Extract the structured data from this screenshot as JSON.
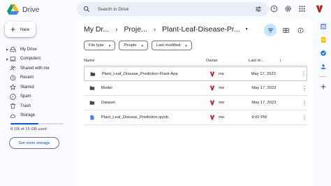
{
  "app": {
    "name": "Drive"
  },
  "search": {
    "placeholder": "Search in Drive"
  },
  "new_button": {
    "label": "New"
  },
  "sidebar": {
    "items": [
      {
        "label": "My Drive",
        "icon": "my-drive-icon",
        "expandable": true
      },
      {
        "label": "Computers",
        "icon": "computer-icon",
        "expandable": true
      },
      {
        "label": "Shared with me",
        "icon": "shared-icon",
        "expandable": false
      },
      {
        "label": "Recent",
        "icon": "clock-icon",
        "expandable": false
      },
      {
        "label": "Starred",
        "icon": "star-icon",
        "expandable": false
      },
      {
        "label": "Spam",
        "icon": "spam-icon",
        "expandable": false
      },
      {
        "label": "Trash",
        "icon": "trash-icon",
        "expandable": false
      },
      {
        "label": "Storage",
        "icon": "cloud-icon",
        "expandable": false
      }
    ],
    "storage_text": "8 GB of 15 GB used",
    "storage_used_fraction": 0.53,
    "get_storage_label": "Get more storage"
  },
  "breadcrumb": {
    "items": [
      "My Dr...",
      "Proje...",
      "Plant-Leaf-Disease-Pr..."
    ]
  },
  "filters": {
    "chips": [
      "File type",
      "People",
      "Last modified"
    ]
  },
  "table": {
    "headers": {
      "name": "Name",
      "owner": "Owner",
      "modified": "Last m..."
    },
    "rows": [
      {
        "name": "Plant_Leaf_Disease_Prediction-Flask-App",
        "type": "folder",
        "owner": "me",
        "modified": "May 17, 2023",
        "selected": true
      },
      {
        "name": "Model",
        "type": "folder",
        "owner": "me",
        "modified": "May 17, 2023",
        "selected": false
      },
      {
        "name": "Dataset",
        "type": "folder",
        "owner": "me",
        "modified": "May 17, 2023",
        "selected": false
      },
      {
        "name": "Plant_Leaf_Disease_Prediction.ipynb",
        "type": "file",
        "owner": "me",
        "modified": "9:02 PM",
        "selected": false
      }
    ]
  },
  "colors": {
    "accent": "#0b57d0",
    "active_chip": "#c2e7ff",
    "avatar": "#b3261e"
  }
}
